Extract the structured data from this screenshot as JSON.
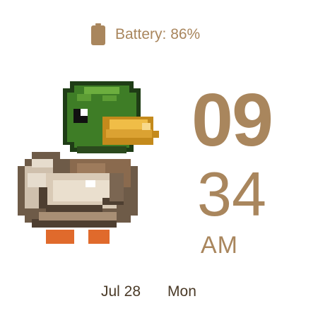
{
  "battery": {
    "icon": "battery-icon",
    "label": "Battery: 86%",
    "level_percent": 86
  },
  "illustration": {
    "icon": "pixel-mallard-duck-icon"
  },
  "time": {
    "hour": "09",
    "minute": "34",
    "ampm": "AM"
  },
  "date": {
    "month_day": "Jul 28",
    "weekday": "Mon"
  },
  "colors": {
    "accent": "#a9865d",
    "date_text": "#4a3a27",
    "background": "#ffffff"
  }
}
